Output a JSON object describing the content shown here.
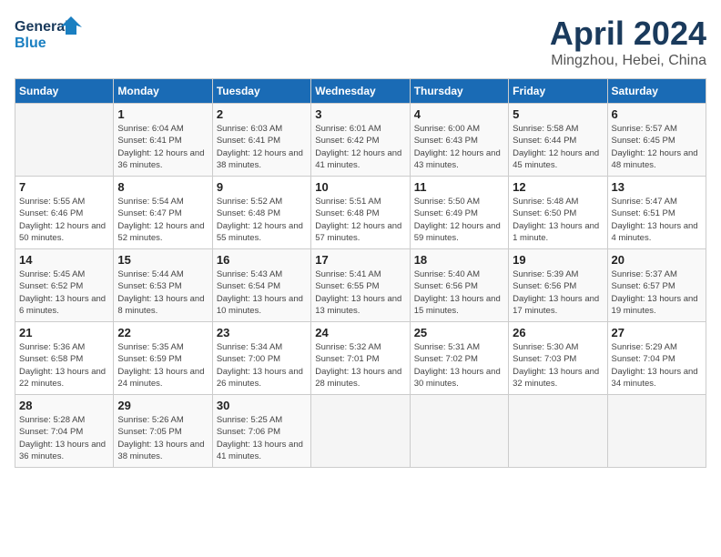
{
  "logo": {
    "line1": "General",
    "line2": "Blue"
  },
  "title": "April 2024",
  "subtitle": "Mingzhou, Hebei, China",
  "days_of_week": [
    "Sunday",
    "Monday",
    "Tuesday",
    "Wednesday",
    "Thursday",
    "Friday",
    "Saturday"
  ],
  "weeks": [
    [
      {
        "day": "",
        "sunrise": "",
        "sunset": "",
        "daylight": ""
      },
      {
        "day": "1",
        "sunrise": "Sunrise: 6:04 AM",
        "sunset": "Sunset: 6:41 PM",
        "daylight": "Daylight: 12 hours and 36 minutes."
      },
      {
        "day": "2",
        "sunrise": "Sunrise: 6:03 AM",
        "sunset": "Sunset: 6:41 PM",
        "daylight": "Daylight: 12 hours and 38 minutes."
      },
      {
        "day": "3",
        "sunrise": "Sunrise: 6:01 AM",
        "sunset": "Sunset: 6:42 PM",
        "daylight": "Daylight: 12 hours and 41 minutes."
      },
      {
        "day": "4",
        "sunrise": "Sunrise: 6:00 AM",
        "sunset": "Sunset: 6:43 PM",
        "daylight": "Daylight: 12 hours and 43 minutes."
      },
      {
        "day": "5",
        "sunrise": "Sunrise: 5:58 AM",
        "sunset": "Sunset: 6:44 PM",
        "daylight": "Daylight: 12 hours and 45 minutes."
      },
      {
        "day": "6",
        "sunrise": "Sunrise: 5:57 AM",
        "sunset": "Sunset: 6:45 PM",
        "daylight": "Daylight: 12 hours and 48 minutes."
      }
    ],
    [
      {
        "day": "7",
        "sunrise": "Sunrise: 5:55 AM",
        "sunset": "Sunset: 6:46 PM",
        "daylight": "Daylight: 12 hours and 50 minutes."
      },
      {
        "day": "8",
        "sunrise": "Sunrise: 5:54 AM",
        "sunset": "Sunset: 6:47 PM",
        "daylight": "Daylight: 12 hours and 52 minutes."
      },
      {
        "day": "9",
        "sunrise": "Sunrise: 5:52 AM",
        "sunset": "Sunset: 6:48 PM",
        "daylight": "Daylight: 12 hours and 55 minutes."
      },
      {
        "day": "10",
        "sunrise": "Sunrise: 5:51 AM",
        "sunset": "Sunset: 6:48 PM",
        "daylight": "Daylight: 12 hours and 57 minutes."
      },
      {
        "day": "11",
        "sunrise": "Sunrise: 5:50 AM",
        "sunset": "Sunset: 6:49 PM",
        "daylight": "Daylight: 12 hours and 59 minutes."
      },
      {
        "day": "12",
        "sunrise": "Sunrise: 5:48 AM",
        "sunset": "Sunset: 6:50 PM",
        "daylight": "Daylight: 13 hours and 1 minute."
      },
      {
        "day": "13",
        "sunrise": "Sunrise: 5:47 AM",
        "sunset": "Sunset: 6:51 PM",
        "daylight": "Daylight: 13 hours and 4 minutes."
      }
    ],
    [
      {
        "day": "14",
        "sunrise": "Sunrise: 5:45 AM",
        "sunset": "Sunset: 6:52 PM",
        "daylight": "Daylight: 13 hours and 6 minutes."
      },
      {
        "day": "15",
        "sunrise": "Sunrise: 5:44 AM",
        "sunset": "Sunset: 6:53 PM",
        "daylight": "Daylight: 13 hours and 8 minutes."
      },
      {
        "day": "16",
        "sunrise": "Sunrise: 5:43 AM",
        "sunset": "Sunset: 6:54 PM",
        "daylight": "Daylight: 13 hours and 10 minutes."
      },
      {
        "day": "17",
        "sunrise": "Sunrise: 5:41 AM",
        "sunset": "Sunset: 6:55 PM",
        "daylight": "Daylight: 13 hours and 13 minutes."
      },
      {
        "day": "18",
        "sunrise": "Sunrise: 5:40 AM",
        "sunset": "Sunset: 6:56 PM",
        "daylight": "Daylight: 13 hours and 15 minutes."
      },
      {
        "day": "19",
        "sunrise": "Sunrise: 5:39 AM",
        "sunset": "Sunset: 6:56 PM",
        "daylight": "Daylight: 13 hours and 17 minutes."
      },
      {
        "day": "20",
        "sunrise": "Sunrise: 5:37 AM",
        "sunset": "Sunset: 6:57 PM",
        "daylight": "Daylight: 13 hours and 19 minutes."
      }
    ],
    [
      {
        "day": "21",
        "sunrise": "Sunrise: 5:36 AM",
        "sunset": "Sunset: 6:58 PM",
        "daylight": "Daylight: 13 hours and 22 minutes."
      },
      {
        "day": "22",
        "sunrise": "Sunrise: 5:35 AM",
        "sunset": "Sunset: 6:59 PM",
        "daylight": "Daylight: 13 hours and 24 minutes."
      },
      {
        "day": "23",
        "sunrise": "Sunrise: 5:34 AM",
        "sunset": "Sunset: 7:00 PM",
        "daylight": "Daylight: 13 hours and 26 minutes."
      },
      {
        "day": "24",
        "sunrise": "Sunrise: 5:32 AM",
        "sunset": "Sunset: 7:01 PM",
        "daylight": "Daylight: 13 hours and 28 minutes."
      },
      {
        "day": "25",
        "sunrise": "Sunrise: 5:31 AM",
        "sunset": "Sunset: 7:02 PM",
        "daylight": "Daylight: 13 hours and 30 minutes."
      },
      {
        "day": "26",
        "sunrise": "Sunrise: 5:30 AM",
        "sunset": "Sunset: 7:03 PM",
        "daylight": "Daylight: 13 hours and 32 minutes."
      },
      {
        "day": "27",
        "sunrise": "Sunrise: 5:29 AM",
        "sunset": "Sunset: 7:04 PM",
        "daylight": "Daylight: 13 hours and 34 minutes."
      }
    ],
    [
      {
        "day": "28",
        "sunrise": "Sunrise: 5:28 AM",
        "sunset": "Sunset: 7:04 PM",
        "daylight": "Daylight: 13 hours and 36 minutes."
      },
      {
        "day": "29",
        "sunrise": "Sunrise: 5:26 AM",
        "sunset": "Sunset: 7:05 PM",
        "daylight": "Daylight: 13 hours and 38 minutes."
      },
      {
        "day": "30",
        "sunrise": "Sunrise: 5:25 AM",
        "sunset": "Sunset: 7:06 PM",
        "daylight": "Daylight: 13 hours and 41 minutes."
      },
      {
        "day": "",
        "sunrise": "",
        "sunset": "",
        "daylight": ""
      },
      {
        "day": "",
        "sunrise": "",
        "sunset": "",
        "daylight": ""
      },
      {
        "day": "",
        "sunrise": "",
        "sunset": "",
        "daylight": ""
      },
      {
        "day": "",
        "sunrise": "",
        "sunset": "",
        "daylight": ""
      }
    ]
  ]
}
